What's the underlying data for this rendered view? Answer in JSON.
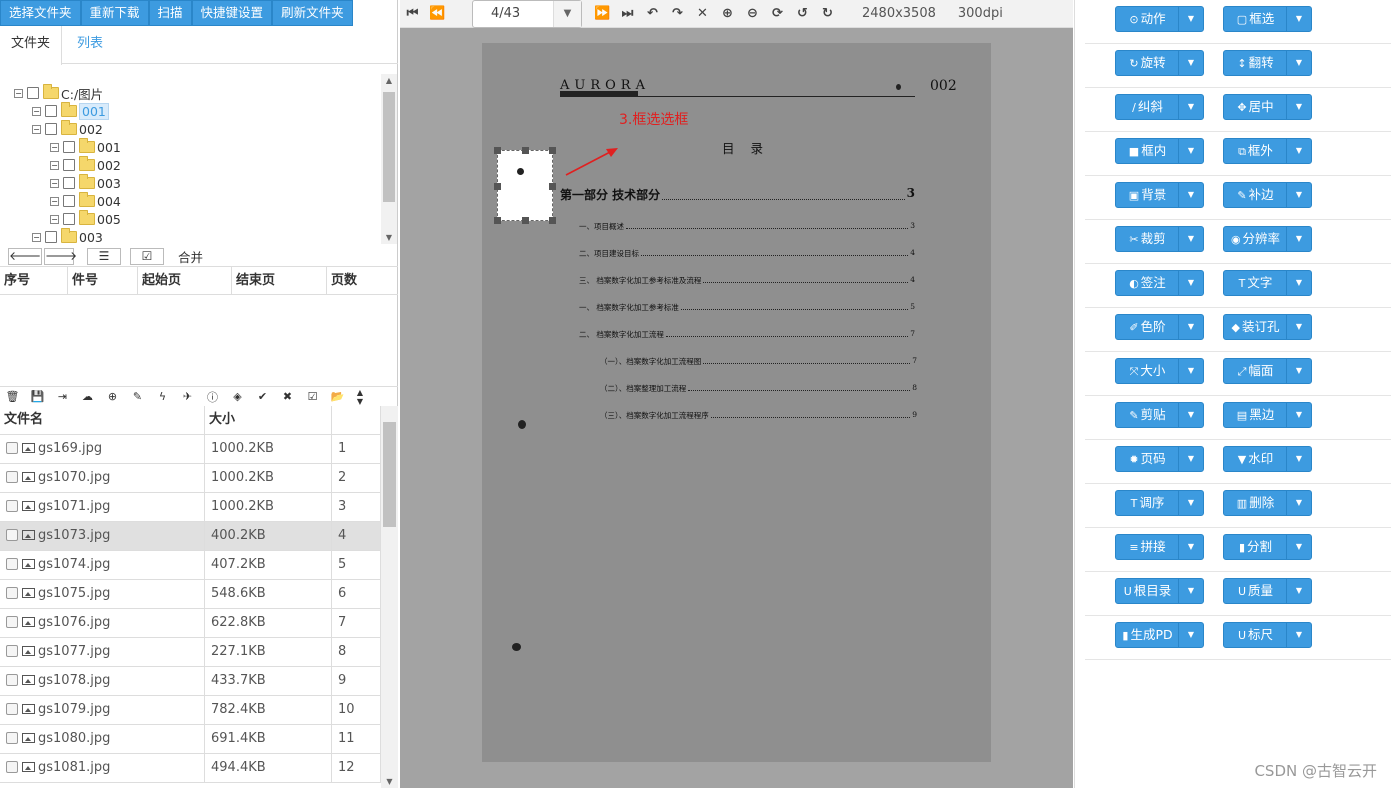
{
  "top_buttons": [
    "选择文件夹",
    "重新下载",
    "扫描",
    "快捷键设置",
    "刷新文件夹"
  ],
  "tabs": [
    "文件夹",
    "列表"
  ],
  "tree": [
    {
      "label": "C:/图片",
      "level": 0,
      "selected": false
    },
    {
      "label": "001",
      "level": 1,
      "selected": true
    },
    {
      "label": "002",
      "level": 1,
      "selected": false
    },
    {
      "label": "001",
      "level": 2,
      "selected": false
    },
    {
      "label": "002",
      "level": 2,
      "selected": false
    },
    {
      "label": "003",
      "level": 2,
      "selected": false
    },
    {
      "label": "004",
      "level": 2,
      "selected": false
    },
    {
      "label": "005",
      "level": 2,
      "selected": false
    },
    {
      "label": "003",
      "level": 1,
      "selected": false
    }
  ],
  "nav": {
    "merge_label": "合并"
  },
  "segment_headers": [
    "序号",
    "件号",
    "起始页",
    "结束页",
    "页数"
  ],
  "file_headers": [
    "文件名",
    "大小",
    ""
  ],
  "files": [
    {
      "name": "gs169.jpg",
      "size": "1000.2KB",
      "index": "1"
    },
    {
      "name": "gs1070.jpg",
      "size": "1000.2KB",
      "index": "2"
    },
    {
      "name": "gs1071.jpg",
      "size": "1000.2KB",
      "index": "3"
    },
    {
      "name": "gs1073.jpg",
      "size": "400.2KB",
      "index": "4"
    },
    {
      "name": "gs1074.jpg",
      "size": "407.2KB",
      "index": "5"
    },
    {
      "name": "gs1075.jpg",
      "size": "548.6KB",
      "index": "6"
    },
    {
      "name": "gs1076.jpg",
      "size": "622.8KB",
      "index": "7"
    },
    {
      "name": "gs1077.jpg",
      "size": "227.1KB",
      "index": "8"
    },
    {
      "name": "gs1078.jpg",
      "size": "433.7KB",
      "index": "9"
    },
    {
      "name": "gs1079.jpg",
      "size": "782.4KB",
      "index": "10"
    },
    {
      "name": "gs1080.jpg",
      "size": "691.4KB",
      "index": "11"
    },
    {
      "name": "gs1081.jpg",
      "size": "494.4KB",
      "index": "12"
    }
  ],
  "selected_file_index": 3,
  "viewer": {
    "page_value": "4/43",
    "dimensions": "2480x3508",
    "dpi": "300dpi"
  },
  "document": {
    "logo": "AURORA",
    "page_number": "002",
    "toc_title": "目 录",
    "annotation": "3.框选选框",
    "toc": [
      {
        "text": "第一部分  技术部分",
        "num": "3"
      },
      {
        "text": "一、项目概述",
        "num": "3"
      },
      {
        "text": "二、项目建设目标",
        "num": "4"
      },
      {
        "text": "三、  档案数字化加工参考标准及流程",
        "num": "4"
      },
      {
        "text": "一、  档案数字化加工参考标准",
        "num": "5"
      },
      {
        "text": "二、  档案数字化加工流程",
        "num": "7"
      },
      {
        "text": "（一）、档案数字化加工流程图",
        "num": "7"
      },
      {
        "text": "（二）、档案整理加工流程",
        "num": "8"
      },
      {
        "text": "（三）、档案数字化加工流程程序",
        "num": "9"
      }
    ]
  },
  "actions": [
    [
      "动作",
      "框选"
    ],
    [
      "旋转",
      "翻转"
    ],
    [
      "纠斜",
      "居中"
    ],
    [
      "框内",
      "框外"
    ],
    [
      "背景",
      "补边"
    ],
    [
      "裁剪",
      "分辨率"
    ],
    [
      "签注",
      "文字"
    ],
    [
      "色阶",
      "装订孔"
    ],
    [
      "大小",
      "幅面"
    ],
    [
      "剪贴",
      "黑边"
    ],
    [
      "页码",
      "水印"
    ],
    [
      "调序",
      "删除"
    ],
    [
      "拼接",
      "分割"
    ],
    [
      "根目录",
      "质量"
    ],
    [
      "生成PD",
      "标尺"
    ]
  ],
  "action_icons": [
    [
      "⊙",
      "▢"
    ],
    [
      "↻",
      "↕"
    ],
    [
      "∕",
      "✥"
    ],
    [
      "■",
      "⧉"
    ],
    [
      "▣",
      "✎"
    ],
    [
      "✂",
      "◉"
    ],
    [
      "◐",
      "T"
    ],
    [
      "✐",
      "◆"
    ],
    [
      "⤧",
      "⤢"
    ],
    [
      "✎",
      "▤"
    ],
    [
      "✹",
      "▼"
    ],
    [
      "T",
      "▥"
    ],
    [
      "≡",
      "▮"
    ],
    [
      "U",
      "U"
    ],
    [
      "▮",
      "U"
    ]
  ],
  "watermark": "CSDN @古智云开",
  "colors": {
    "accent": "#3d9be0",
    "annotation": "#e02020"
  }
}
